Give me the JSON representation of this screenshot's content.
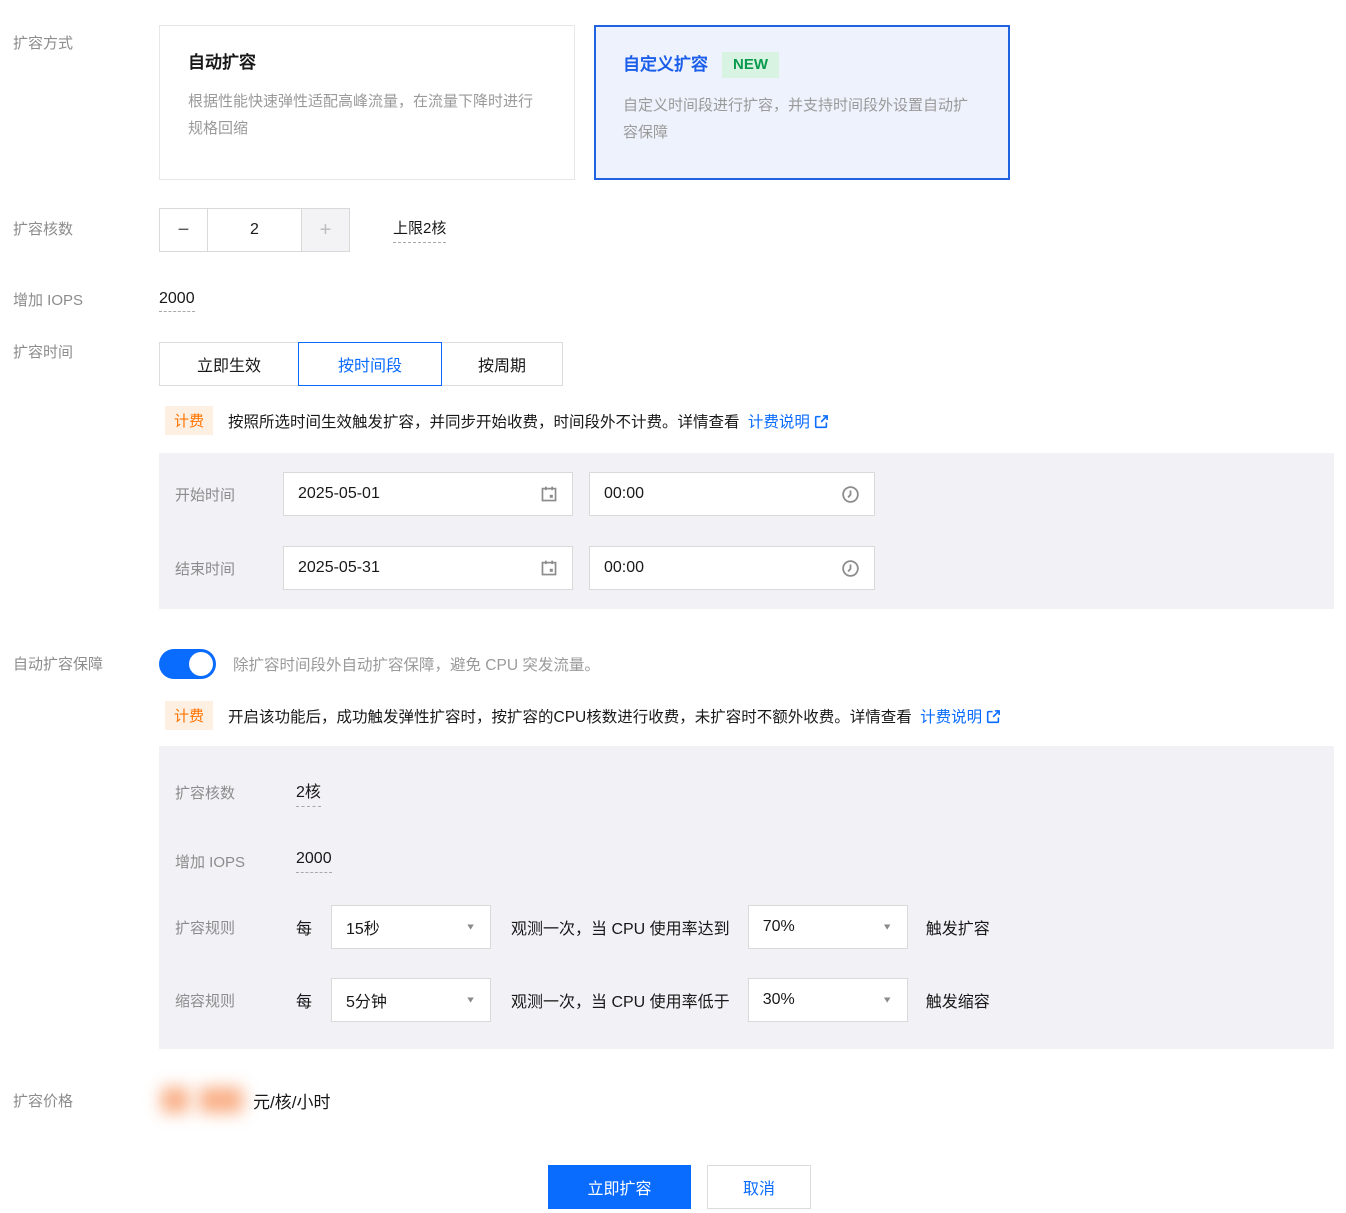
{
  "colors": {
    "primary_blue": "#0a6cff",
    "selected_card_border": "#2063e0",
    "selected_card_bg": "#edf2fc",
    "new_badge_bg": "#d9f3e3",
    "new_badge_text": "#0a9a4e",
    "billing_badge_bg": "#fdf0e2",
    "billing_badge_text": "#ff7200",
    "panel_bg": "#f2f2f6"
  },
  "method": {
    "label": "扩容方式",
    "cards": [
      {
        "title": "自动扩容",
        "desc": "根据性能快速弹性适配高峰流量，在流量下降时进行规格回缩",
        "selected": false
      },
      {
        "title": "自定义扩容",
        "badge": "NEW",
        "desc": "自定义时间段进行扩容，并支持时间段外设置自动扩容保障",
        "selected": true
      }
    ]
  },
  "cores": {
    "label": "扩容核数",
    "minus": "−",
    "plus": "+",
    "value": "2",
    "limit": "上限2核"
  },
  "iops": {
    "label": "增加 IOPS",
    "value": "2000"
  },
  "time": {
    "label": "扩容时间",
    "tabs": [
      {
        "label": "立即生效"
      },
      {
        "label": "按时间段",
        "active": true
      },
      {
        "label": "按周期"
      }
    ],
    "billing_badge": "计费",
    "billing_text": "按照所选时间生效触发扩容，并同步开始收费，时间段外不计费。详情查看",
    "billing_link": "计费说明",
    "start": {
      "label": "开始时间",
      "date": "2025-05-01",
      "time": "00:00"
    },
    "end": {
      "label": "结束时间",
      "date": "2025-05-31",
      "time": "00:00"
    }
  },
  "guard": {
    "label": "自动扩容保障",
    "toggle_on": true,
    "desc": "除扩容时间段外自动扩容保障，避免 CPU 突发流量。",
    "billing_badge": "计费",
    "billing_text": "开启该功能后，成功触发弹性扩容时，按扩容的CPU核数进行收费，未扩容时不额外收费。详情查看",
    "billing_link": "计费说明",
    "cores_label": "扩容核数",
    "cores_value": "2核",
    "iops_label": "增加 IOPS",
    "iops_value": "2000",
    "expand_rule": {
      "label": "扩容规则",
      "prefix": "每",
      "interval": "15秒",
      "middle": "观测一次，当 CPU 使用率达到",
      "threshold": "70%",
      "suffix": "触发扩容"
    },
    "shrink_rule": {
      "label": "缩容规则",
      "prefix": "每",
      "interval": "5分钟",
      "middle": "观测一次，当 CPU 使用率低于",
      "threshold": "30%",
      "suffix": "触发缩容"
    }
  },
  "price": {
    "label": "扩容价格",
    "unit": "元/核/小时"
  },
  "actions": {
    "confirm": "立即扩容",
    "cancel": "取消"
  }
}
